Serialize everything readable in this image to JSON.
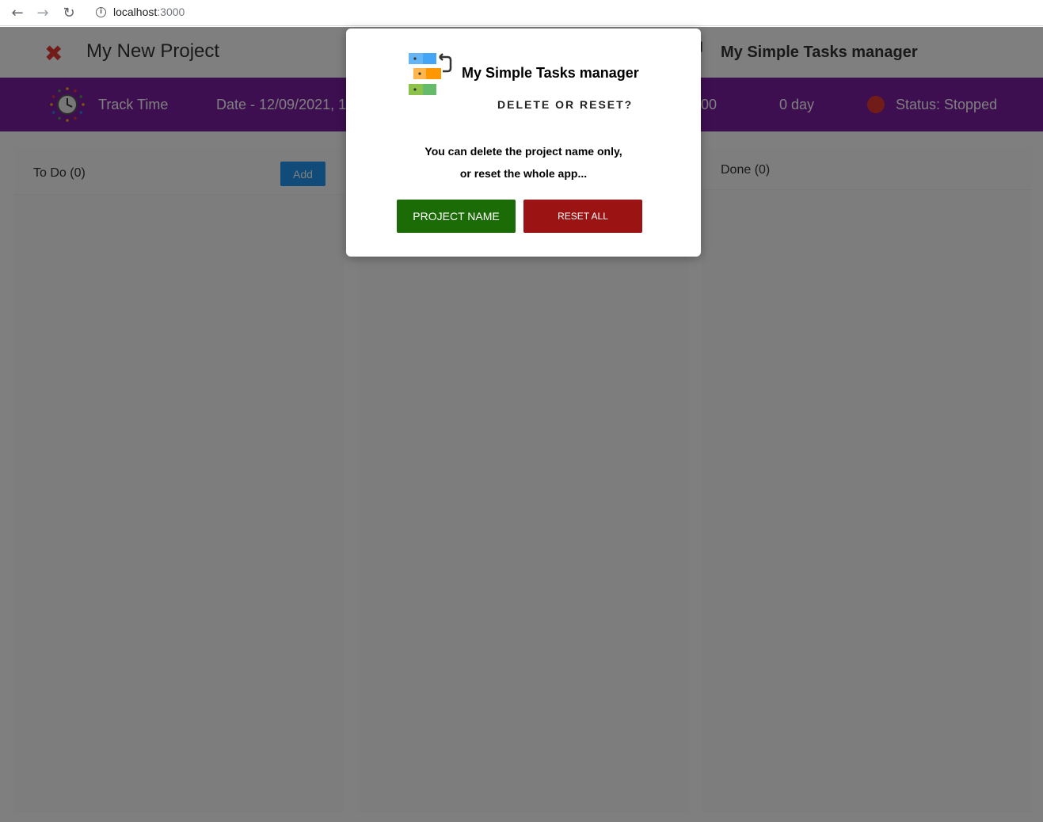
{
  "browser": {
    "back_icon": "arrow-left-icon",
    "forward_icon": "arrow-right-icon",
    "reload_icon": "reload-icon",
    "url_host": "localhost",
    "url_port": ":3000"
  },
  "header": {
    "close_icon": "close-icon",
    "project_title": "My New Project",
    "app_name": "My Simple Tasks manager"
  },
  "timebar": {
    "clock_icon": "clock-icon",
    "track_label": "Track Time",
    "date_text": "Date - 12/09/2021, 1",
    "timer_fragment": "00",
    "days_text": "0 day",
    "status_text": "Status: Stopped",
    "bar_color": "#7b1fa2",
    "status_dot_color": "#e53935"
  },
  "columns": [
    {
      "title": "To Do (0)",
      "add_label": "Add"
    },
    {
      "title": ""
    },
    {
      "title": "Done (0)"
    }
  ],
  "modal": {
    "logo_icon": "tasks-logo-icon",
    "app_name": "My Simple Tasks manager",
    "heading": "DELETE OR RESET?",
    "message_line1": "You can delete the project name only,",
    "message_line2": "or reset the whole app...",
    "project_name_label": "PROJECT NAME",
    "reset_all_label": "RESET ALL",
    "project_btn_color": "#1b6b06",
    "reset_btn_color": "#9b1313"
  }
}
